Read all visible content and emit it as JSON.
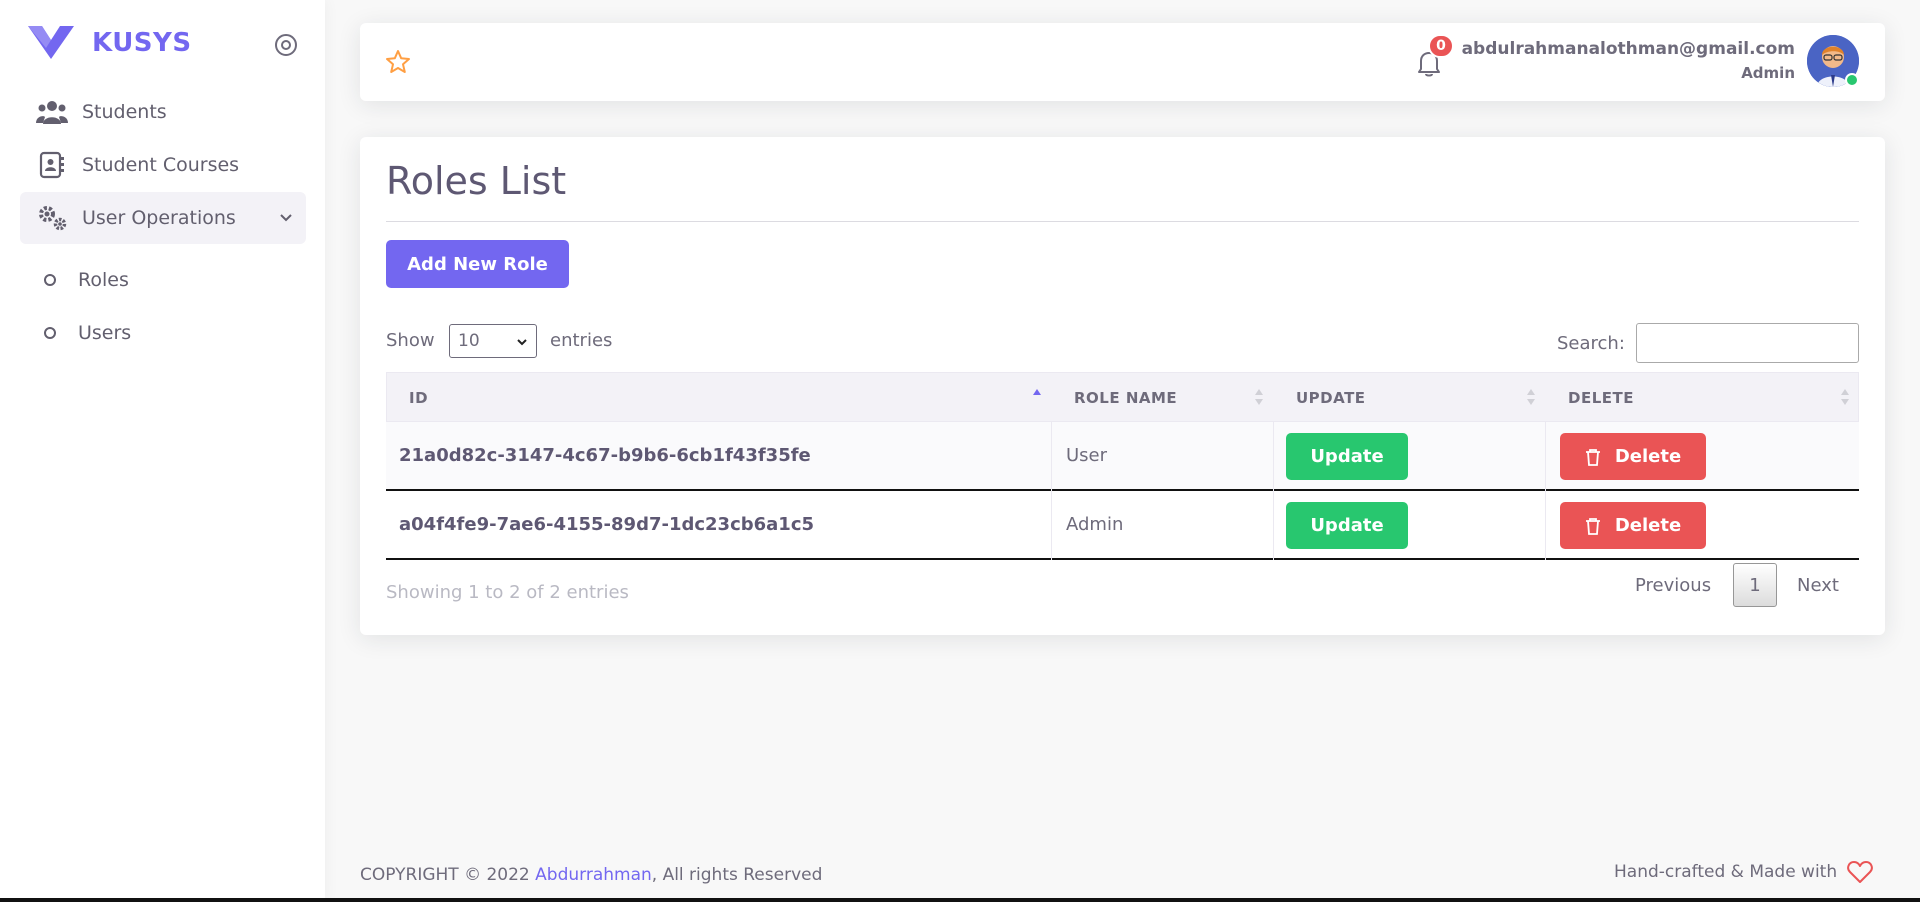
{
  "brand": {
    "name": "KUSYS"
  },
  "sidebar": {
    "items": [
      {
        "label": "Students",
        "icon": "users-icon"
      },
      {
        "label": "Student Courses",
        "icon": "contact-book-icon"
      },
      {
        "label": "User Operations",
        "icon": "gears-icon",
        "open": true
      }
    ],
    "subitems": [
      {
        "label": "Roles"
      },
      {
        "label": "Users"
      }
    ]
  },
  "navbar": {
    "notifications": "0",
    "email": "abdulrahmanalothman@gmail.com",
    "role": "Admin"
  },
  "page": {
    "title": "Roles List",
    "add_button": "Add New Role",
    "show_label": "Show",
    "entries_value": "10",
    "entries_label": "entries",
    "search_label": "Search:",
    "search_value": ""
  },
  "table": {
    "headers": [
      "ID",
      "ROLE NAME",
      "UPDATE",
      "DELETE"
    ],
    "rows": [
      {
        "id": "21a0d82c-3147-4c67-b9b6-6cb1f43f35fe",
        "role": "User",
        "update": "Update",
        "delete": "Delete"
      },
      {
        "id": "a04f4fe9-7ae6-4155-89d7-1dc23cb6a1c5",
        "role": "Admin",
        "update": "Update",
        "delete": "Delete"
      }
    ],
    "info": "Showing 1 to 2 of 2 entries",
    "pagination": {
      "prev": "Previous",
      "page": "1",
      "next": "Next"
    }
  },
  "footer": {
    "copyright_prefix": "COPYRIGHT © 2022 ",
    "author": "Abdurrahman",
    "copyright_suffix": ", All rights Reserved",
    "made_with": "Hand-crafted & Made with"
  },
  "colors": {
    "primary": "#7367f0",
    "success": "#28c76f",
    "danger": "#ea5455",
    "warning": "#ff9f43"
  }
}
